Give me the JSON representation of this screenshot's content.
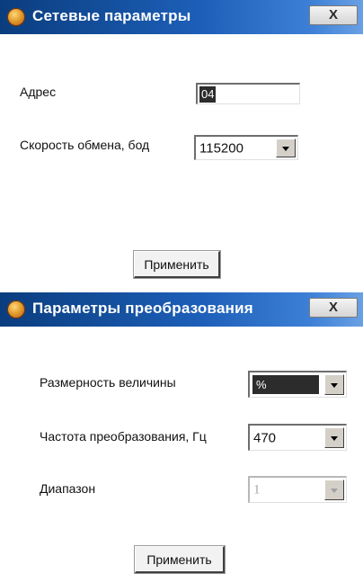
{
  "network_dialog": {
    "title": "Сетевые параметры",
    "close_label": "X",
    "address_label": "Адрес",
    "address_value": "04",
    "baud_label": "Скорость обмена, бод",
    "baud_value": "115200",
    "apply_label": "Применить"
  },
  "conversion_dialog": {
    "title": "Параметры преобразования",
    "close_label": "X",
    "dimension_label": "Размерность величины",
    "dimension_value": "%",
    "frequency_label": "Частота преобразования, Гц",
    "frequency_value": "470",
    "range_label": "Диапазон",
    "range_value": "1",
    "apply_label": "Применить"
  },
  "icons": {
    "app": "app-icon",
    "close": "close-icon",
    "dropdown": "chevron-down-icon"
  }
}
